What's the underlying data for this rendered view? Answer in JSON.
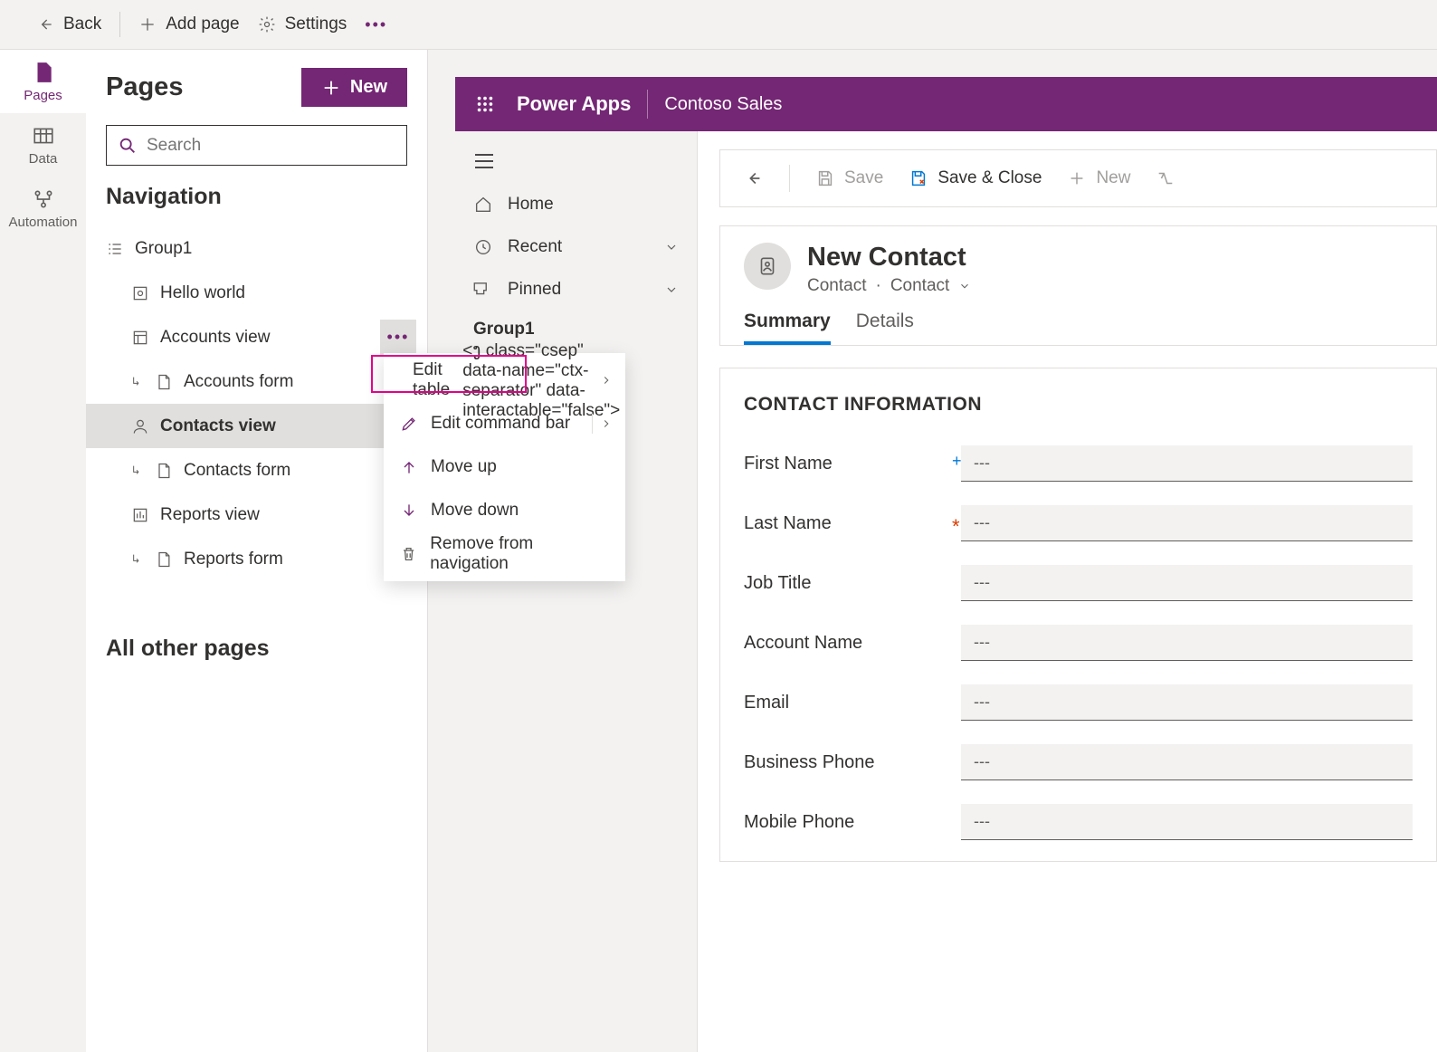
{
  "toolbar": {
    "back": "Back",
    "addPage": "Add page",
    "settings": "Settings"
  },
  "leftRail": [
    {
      "id": "pages",
      "label": "Pages",
      "active": true
    },
    {
      "id": "data",
      "label": "Data",
      "active": false
    },
    {
      "id": "automation",
      "label": "Automation",
      "active": false
    }
  ],
  "pagesPanel": {
    "title": "Pages",
    "newLabel": "New",
    "searchPlaceholder": "Search",
    "navTitle": "Navigation",
    "allOther": "All other pages",
    "tree": {
      "group": "Group1",
      "items": [
        {
          "kind": "dashboard",
          "label": "Hello world"
        },
        {
          "kind": "view",
          "label": "Accounts view",
          "hot": true
        },
        {
          "kind": "form",
          "label": "Accounts form",
          "sub": true
        },
        {
          "kind": "view",
          "label": "Contacts view",
          "selected": true,
          "iconKind": "person"
        },
        {
          "kind": "form",
          "label": "Contacts form",
          "sub": true
        },
        {
          "kind": "view",
          "label": "Reports view",
          "iconKind": "chart"
        },
        {
          "kind": "form",
          "label": "Reports form",
          "sub": true
        }
      ]
    }
  },
  "contextMenu": {
    "items": [
      {
        "icon": "pencil",
        "label": "Edit table",
        "hasSub": true
      },
      {
        "icon": "pencil",
        "label": "Edit command bar",
        "hasSub": true
      },
      {
        "icon": "arrow-up",
        "label": "Move up"
      },
      {
        "icon": "arrow-down",
        "label": "Move down"
      },
      {
        "icon": "trash",
        "label": "Remove from navigation",
        "gray": true
      }
    ]
  },
  "appPreview": {
    "appName": "Power Apps",
    "envName": "Contoso Sales",
    "sideNav": {
      "home": "Home",
      "recent": "Recent",
      "pinned": "Pinned",
      "group": "Group1"
    },
    "commandBar": {
      "save": "Save",
      "saveClose": "Save & Close",
      "new": "New"
    },
    "form": {
      "title": "New Contact",
      "entity": "Contact",
      "formName": "Contact",
      "tabs": {
        "summary": "Summary",
        "details": "Details"
      },
      "section": "CONTACT INFORMATION",
      "placeholder": "---",
      "fields": [
        {
          "label": "First Name",
          "req": "blue"
        },
        {
          "label": "Last Name",
          "req": "red"
        },
        {
          "label": "Job Title"
        },
        {
          "label": "Account Name"
        },
        {
          "label": "Email"
        },
        {
          "label": "Business Phone"
        },
        {
          "label": "Mobile Phone"
        }
      ]
    }
  }
}
